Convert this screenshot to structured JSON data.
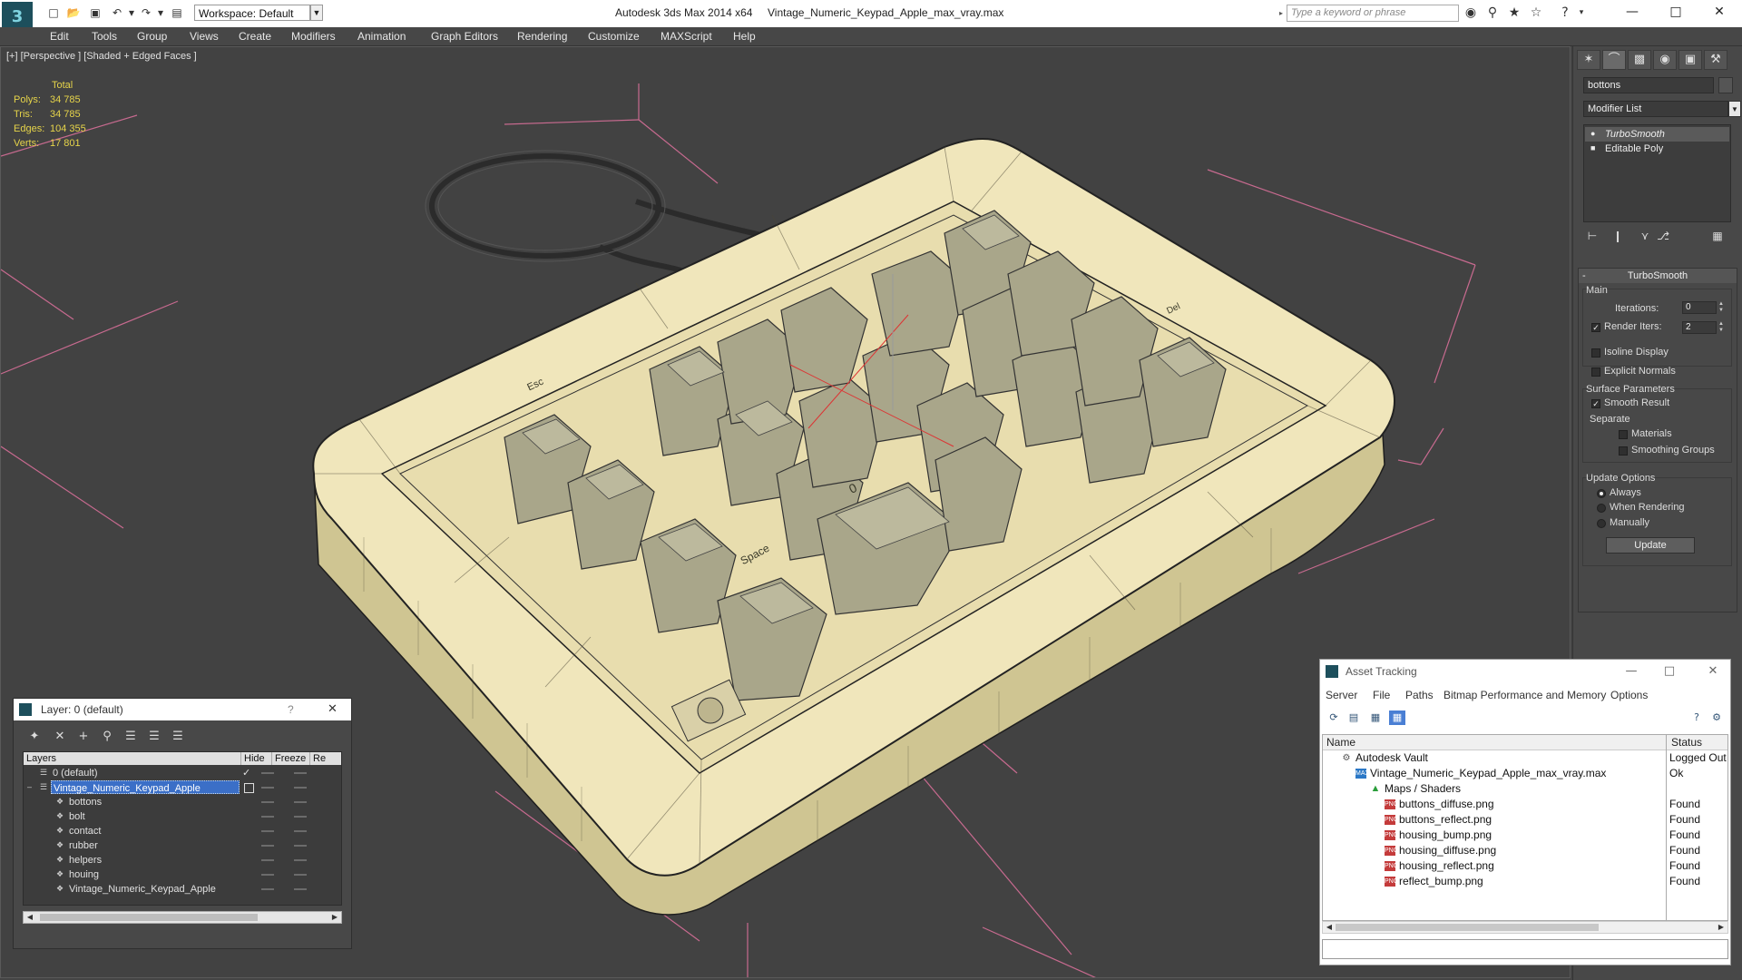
{
  "titlebar": {
    "app_title": "Autodesk 3ds Max  2014 x64",
    "file_title": "Vintage_Numeric_Keypad_Apple_max_vray.max",
    "workspace": "Workspace: Default",
    "search_placeholder": "Type a keyword or phrase"
  },
  "menu": [
    "Edit",
    "Tools",
    "Group",
    "Views",
    "Create",
    "Modifiers",
    "Animation",
    "Graph Editors",
    "Rendering",
    "Customize",
    "MAXScript",
    "Help"
  ],
  "viewport": {
    "label": "[+] [Perspective ] [Shaded + Edged Faces ]",
    "stats": {
      "header": "Total",
      "rows": [
        {
          "label": "Polys:",
          "value": "34 785"
        },
        {
          "label": "Tris:",
          "value": "34 785"
        },
        {
          "label": "Edges:",
          "value": "104 355"
        },
        {
          "label": "Verts:",
          "value": "17 801"
        }
      ]
    },
    "key_labels": [
      "Esc",
      "Space",
      "0",
      "Del"
    ]
  },
  "command_panel": {
    "object_name": "bottons",
    "modifier_list": "Modifier List",
    "stack": [
      "TurboSmooth",
      "Editable Poly"
    ],
    "rollout_title": "TurboSmooth",
    "main_label": "Main",
    "iterations_label": "Iterations:",
    "iterations_value": "0",
    "render_iters_label": "Render Iters:",
    "render_iters_value": "2",
    "isoline_label": "Isoline Display",
    "explicit_normals_label": "Explicit Normals",
    "surface_params_label": "Surface Parameters",
    "smooth_result_label": "Smooth Result",
    "separate_label": "Separate",
    "materials_label": "Materials",
    "smoothing_groups_label": "Smoothing Groups",
    "update_options_label": "Update Options",
    "always_label": "Always",
    "when_rendering_label": "When Rendering",
    "manually_label": "Manually",
    "update_button": "Update"
  },
  "layer_window": {
    "title": "Layer: 0 (default)",
    "help": "?",
    "columns": [
      "Layers",
      "Hide",
      "Freeze",
      "Re"
    ],
    "rows": [
      {
        "name": "0 (default)",
        "indent": 1,
        "checked": true
      },
      {
        "name": "Vintage_Numeric_Keypad_Apple",
        "indent": 1,
        "selected": true
      },
      {
        "name": "bottons",
        "indent": 2
      },
      {
        "name": "bolt",
        "indent": 2
      },
      {
        "name": "contact",
        "indent": 2
      },
      {
        "name": "rubber",
        "indent": 2
      },
      {
        "name": "helpers",
        "indent": 2
      },
      {
        "name": "houing",
        "indent": 2
      },
      {
        "name": "Vintage_Numeric_Keypad_Apple",
        "indent": 2
      }
    ]
  },
  "asset_window": {
    "title": "Asset Tracking",
    "menu": [
      "Server",
      "File",
      "Paths",
      "Bitmap Performance and Memory",
      "Options"
    ],
    "columns": [
      "Name",
      "Status"
    ],
    "rows": [
      {
        "name": "Autodesk Vault",
        "status": "Logged Out",
        "indent": 0,
        "icon": "vault"
      },
      {
        "name": "Vintage_Numeric_Keypad_Apple_max_vray.max",
        "status": "Ok",
        "indent": 1,
        "icon": "max"
      },
      {
        "name": "Maps / Shaders",
        "status": "",
        "indent": 2,
        "icon": "maps"
      },
      {
        "name": "buttons_diffuse.png",
        "status": "Found",
        "indent": 3,
        "icon": "png"
      },
      {
        "name": "buttons_reflect.png",
        "status": "Found",
        "indent": 3,
        "icon": "png"
      },
      {
        "name": "housing_bump.png",
        "status": "Found",
        "indent": 3,
        "icon": "png"
      },
      {
        "name": "housing_diffuse.png",
        "status": "Found",
        "indent": 3,
        "icon": "png"
      },
      {
        "name": "housing_reflect.png",
        "status": "Found",
        "indent": 3,
        "icon": "png"
      },
      {
        "name": "reflect_bump.png",
        "status": "Found",
        "indent": 3,
        "icon": "png"
      }
    ]
  }
}
